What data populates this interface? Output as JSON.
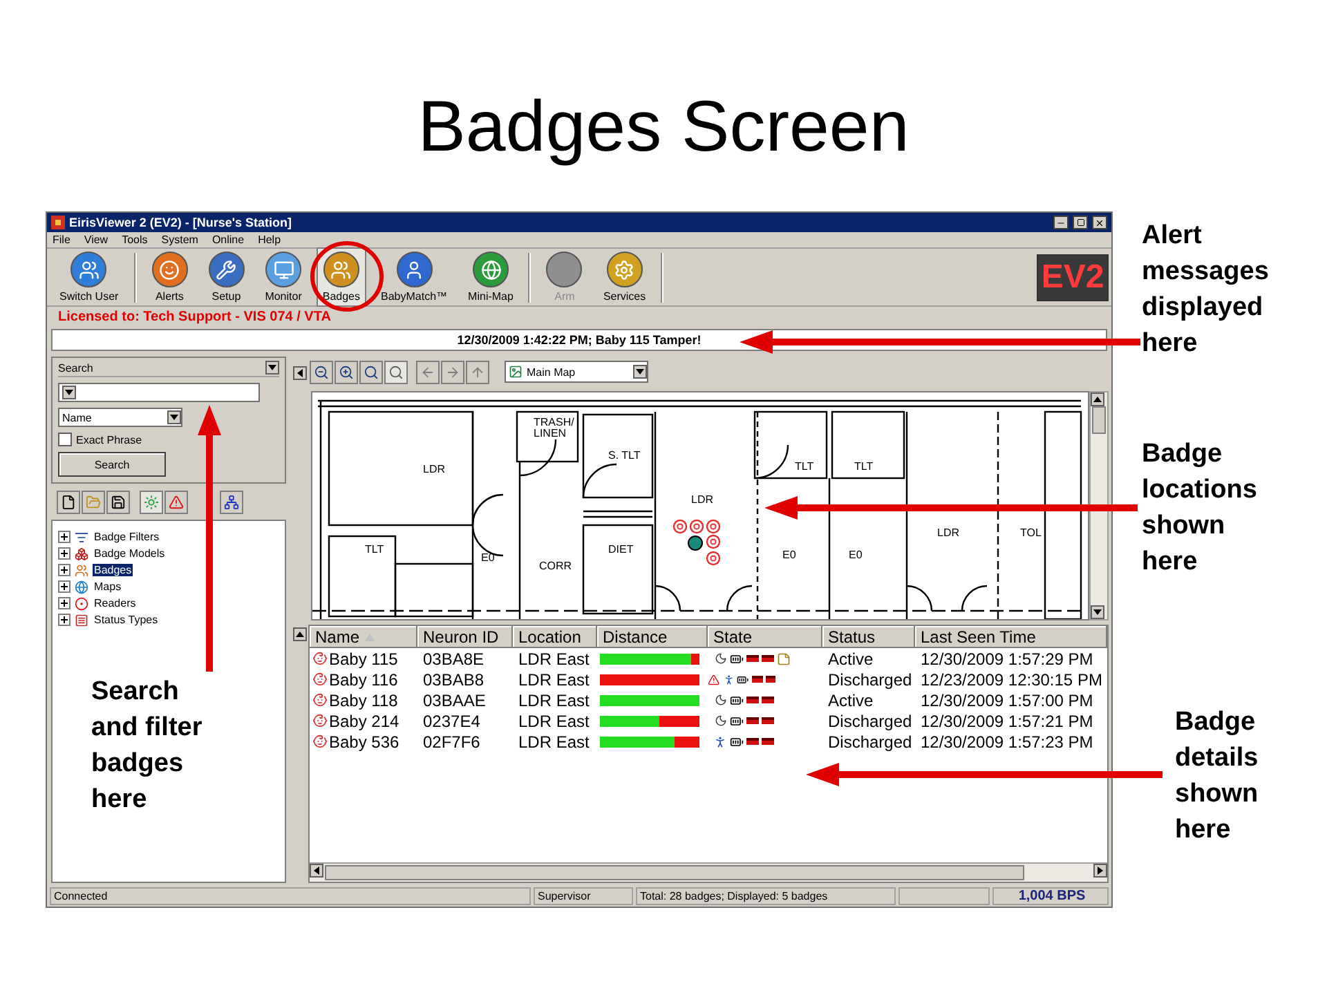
{
  "slide": {
    "title": "Badges Screen"
  },
  "window": {
    "title": "EirisViewer 2 (EV2) - [Nurse's Station]"
  },
  "menu": [
    "File",
    "View",
    "Tools",
    "System",
    "Online",
    "Help"
  ],
  "toolbar": [
    {
      "label": "Switch User",
      "selected": false,
      "disabled": false
    },
    {
      "label": "Alerts",
      "selected": false,
      "disabled": false
    },
    {
      "label": "Setup",
      "selected": false,
      "disabled": false
    },
    {
      "label": "Monitor",
      "selected": false,
      "disabled": false
    },
    {
      "label": "Badges",
      "selected": true,
      "disabled": false
    },
    {
      "label": "BabyMatch™",
      "selected": false,
      "disabled": false
    },
    {
      "label": "Mini-Map",
      "selected": false,
      "disabled": false
    },
    {
      "label": "Arm",
      "selected": false,
      "disabled": true
    },
    {
      "label": "Services",
      "selected": false,
      "disabled": false
    }
  ],
  "logo": "EV2",
  "license": "Licensed to: Tech Support - VIS 074 / VTA",
  "alert": "12/30/2009 1:42:22 PM; Baby 115 Tamper!",
  "search": {
    "title": "Search",
    "field": "Name",
    "exact_phrase": {
      "label": "Exact Phrase",
      "checked": false
    },
    "button": "Search"
  },
  "tree": [
    {
      "label": "Badge Filters",
      "selected": false,
      "expanded": false
    },
    {
      "label": "Badge Models",
      "selected": false,
      "expanded": false
    },
    {
      "label": "Badges",
      "selected": true,
      "expanded": false
    },
    {
      "label": "Maps",
      "selected": false,
      "expanded": false
    },
    {
      "label": "Readers",
      "selected": false,
      "expanded": false
    },
    {
      "label": "Status Types",
      "selected": false,
      "expanded": false
    }
  ],
  "map": {
    "selector": "Main Map",
    "labels": [
      "LDR",
      "TRASH/",
      "LINEN",
      "S. TLT",
      "TLT",
      "TLT",
      "LDR",
      "LDR",
      "TLT",
      "E0",
      "CORR",
      "DIET",
      "E0",
      "E0",
      "TOL"
    ]
  },
  "table": {
    "columns": [
      {
        "label": "Name",
        "sorted": true
      },
      {
        "label": "Neuron ID",
        "sorted": false
      },
      {
        "label": "Location",
        "sorted": false
      },
      {
        "label": "Distance",
        "sorted": false
      },
      {
        "label": "State",
        "sorted": false
      },
      {
        "label": "Status",
        "sorted": false
      },
      {
        "label": "Last Seen Time",
        "sorted": false
      }
    ],
    "rows": [
      {
        "name": "Baby 115",
        "neuron_id": "03BA8E",
        "location": "LDR East",
        "level": 0.92,
        "sleeping": true,
        "alert": false,
        "moving": false,
        "note": true,
        "status": "Active",
        "last_seen": "12/30/2009 1:57:29 PM"
      },
      {
        "name": "Baby 116",
        "neuron_id": "03BAB8",
        "location": "LDR East",
        "level": 0,
        "sleeping": false,
        "alert": true,
        "moving": true,
        "note": false,
        "status": "Discharged",
        "last_seen": "12/23/2009 12:30:15 PM"
      },
      {
        "name": "Baby 118",
        "neuron_id": "03BAAE",
        "location": "LDR East",
        "level": 1,
        "sleeping": true,
        "alert": false,
        "moving": false,
        "note": false,
        "status": "Active",
        "last_seen": "12/30/2009 1:57:00 PM"
      },
      {
        "name": "Baby 214",
        "neuron_id": "0237E4",
        "location": "LDR East",
        "level": 0.6,
        "sleeping": true,
        "alert": false,
        "moving": false,
        "note": false,
        "status": "Discharged",
        "last_seen": "12/30/2009 1:57:21 PM"
      },
      {
        "name": "Baby 536",
        "neuron_id": "02F7F6",
        "location": "LDR East",
        "level": 0.75,
        "sleeping": false,
        "alert": false,
        "moving": true,
        "note": false,
        "status": "Discharged",
        "last_seen": "12/30/2009 1:57:23 PM"
      }
    ]
  },
  "status_bar": {
    "connection": "Connected",
    "user": "Supervisor",
    "totals": "Total: 28 badges; Displayed: 5 badges",
    "rate": "1,004 BPS"
  },
  "annotations": [
    "Alert messages displayed here",
    "Badge locations shown here",
    "Badge details shown here",
    "Search and filter badges here"
  ]
}
